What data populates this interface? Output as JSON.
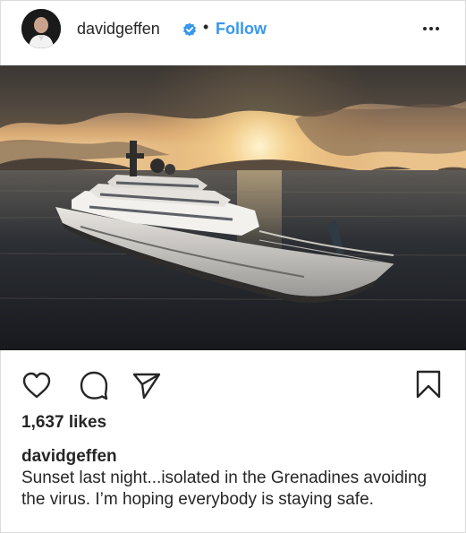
{
  "post": {
    "username": "davidgeffen",
    "separator": "•",
    "follow_label": "Follow",
    "verified_color": "#3897f0",
    "likes_text": "1,637 likes",
    "caption_username": "davidgeffen",
    "caption_text": "Sunset last night...isolated in the Grenadines avoiding the virus. I’m hoping everybody is staying safe."
  },
  "icons": {
    "avatar": "avatar",
    "verified": "verified-badge-icon",
    "more": "more-options-icon",
    "like": "heart-icon",
    "comment": "comment-icon",
    "share": "share-icon",
    "save": "bookmark-icon"
  },
  "colors": {
    "accent": "#3897f0",
    "text": "#262626",
    "border": "#dbdbdb"
  }
}
